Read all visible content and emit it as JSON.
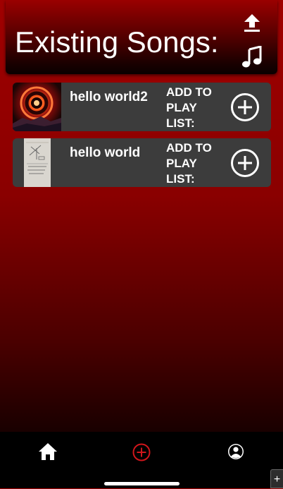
{
  "header": {
    "title": "Existing Songs:",
    "upload_icon": "upload-icon",
    "music_icon": "music-note-icon"
  },
  "songs": [
    {
      "title": "hello world2",
      "add_label": "ADD TO PLAY LIST:",
      "thumbnail": "red-eclipse-artwork"
    },
    {
      "title": "hello world",
      "add_label": "ADD TO PLAY LIST:",
      "thumbnail": "sketch-paper-artwork"
    }
  ],
  "nav": {
    "home_icon": "home-icon",
    "add_icon": "add-circle-icon",
    "profile_icon": "profile-icon",
    "active": "add"
  },
  "corner_tab": {
    "label": "+"
  },
  "colors": {
    "accent": "#d0161b",
    "card": "#3c3c3c",
    "background_top": "#a00000",
    "nav_bg": "#000000"
  }
}
